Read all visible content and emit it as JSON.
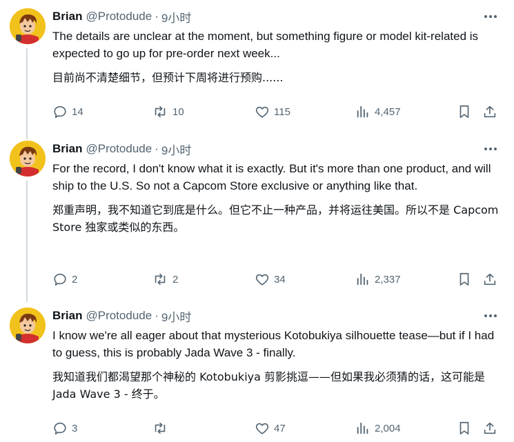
{
  "tweets": [
    {
      "name": "Brian",
      "handle": "@Protodude",
      "separator": "·",
      "time": "9小时",
      "text_en": "The details are unclear at the moment, but something figure or model kit-related is expected to go up for pre-order next week...",
      "text_zh": "目前尚不清楚细节，但预计下周将进行预购......",
      "replies": "14",
      "retweets": "10",
      "likes": "115",
      "views": "4,457"
    },
    {
      "name": "Brian",
      "handle": "@Protodude",
      "separator": "·",
      "time": "9小时",
      "text_en": "For the record, I don't know what it is exactly. But it's more than one product, and will ship to the U.S. So not a Capcom Store exclusive or anything like that.",
      "text_zh": "郑重声明，我不知道它到底是什么。但它不止一种产品，并将运往美国。所以不是 Capcom Store 独家或类似的东西。",
      "replies": "2",
      "retweets": "2",
      "likes": "34",
      "views": "2,337"
    },
    {
      "name": "Brian",
      "handle": "@Protodude",
      "separator": "·",
      "time": "9小时",
      "text_en": "I know we're all eager about that mysterious Kotobukiya silhouette tease—but if I had to guess, this is probably Jada Wave 3 - finally.",
      "text_zh": "我知道我们都渴望那个神秘的 Kotobukiya 剪影挑逗——但如果我必须猜的话，这可能是 Jada Wave 3 - 终于。",
      "replies": "3",
      "retweets": "",
      "likes": "47",
      "views": "2,004"
    }
  ],
  "icons": {
    "avatar": "cartoon-avatar",
    "more": "more-icon",
    "reply": "reply-icon",
    "retweet": "retweet-icon",
    "like": "heart-icon",
    "views": "views-icon",
    "bookmark": "bookmark-icon",
    "share": "share-icon"
  },
  "colors": {
    "text": "#0f1419",
    "secondary": "#536471",
    "thread_line": "#cfd9de",
    "avatar_bg": "#f2c21c"
  }
}
